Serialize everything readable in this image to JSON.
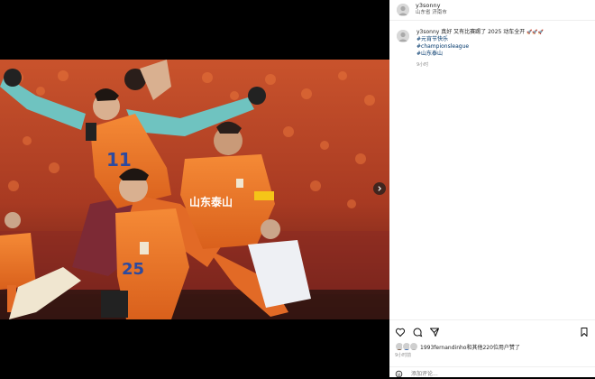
{
  "post": {
    "username": "y3sonny",
    "location": "山东省 济南市"
  },
  "caption": {
    "username": "y3sonny",
    "text": "真好 又有比赛踢了 2025 动车全开",
    "emoji": "🚀🚀🚀",
    "hashtags": [
      "#元宵节快乐",
      "#championsleague",
      "#山东泰山"
    ],
    "time": "9小时"
  },
  "photo": {
    "jersey_numbers": [
      "11",
      "25"
    ],
    "sponsor_text": "山东泰山"
  },
  "likes": {
    "text": "1993fernandinho和其他220位用户赞了",
    "time": "9小时前"
  },
  "comment": {
    "placeholder": "添加评论..."
  },
  "icons": {
    "like": "heart-icon",
    "comment": "comment-icon",
    "share": "send-icon",
    "save": "bookmark-icon",
    "next": "chevron-right-icon",
    "emoji": "smiley-icon"
  },
  "colors": {
    "jersey_orange": "#f07a2a",
    "tag_blue": "#00376b",
    "gk_teal": "#6fc3c0",
    "opp_maroon": "#7d2a35"
  }
}
